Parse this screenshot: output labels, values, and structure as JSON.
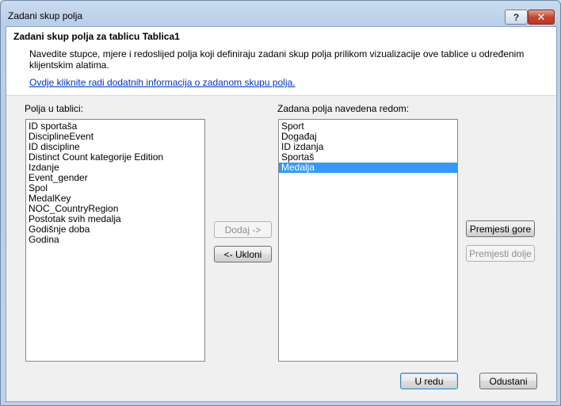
{
  "window": {
    "title": "Zadani skup polja"
  },
  "header": {
    "title": "Zadani skup polja za tablicu Tablica1",
    "description": "Navedite stupce, mjere i redoslijed polja koji definiraju zadani skup polja prilikom vizualizacije ove tablice u određenim klijentskim alatima.",
    "link": "Ovdje kliknite radi dodatnih informacija o zadanom skupu polja."
  },
  "left_list": {
    "label": "Polja u tablici:",
    "items": [
      "ID sportaša",
      "DisciplineEvent",
      "ID discipline",
      "Distinct Count kategorije Edition",
      "Izdanje",
      "Event_gender",
      "Spol",
      "MedalKey",
      "NOC_CountryRegion",
      "Postotak svih medalja",
      "Godišnje doba",
      "Godina"
    ]
  },
  "right_list": {
    "label": "Zadana polja navedena redom:",
    "items": [
      "Sport",
      "Događaj",
      "ID izdanja",
      "Sportaš",
      "Medalja"
    ],
    "selected": "Medalja"
  },
  "buttons": {
    "add": "Dodaj ->",
    "remove": "<- Ukloni",
    "move_up": "Premjesti gore",
    "move_down": "Premjesti dolje",
    "ok": "U redu",
    "cancel": "Odustani"
  },
  "icons": {
    "help": "help-icon",
    "close": "close-icon"
  }
}
